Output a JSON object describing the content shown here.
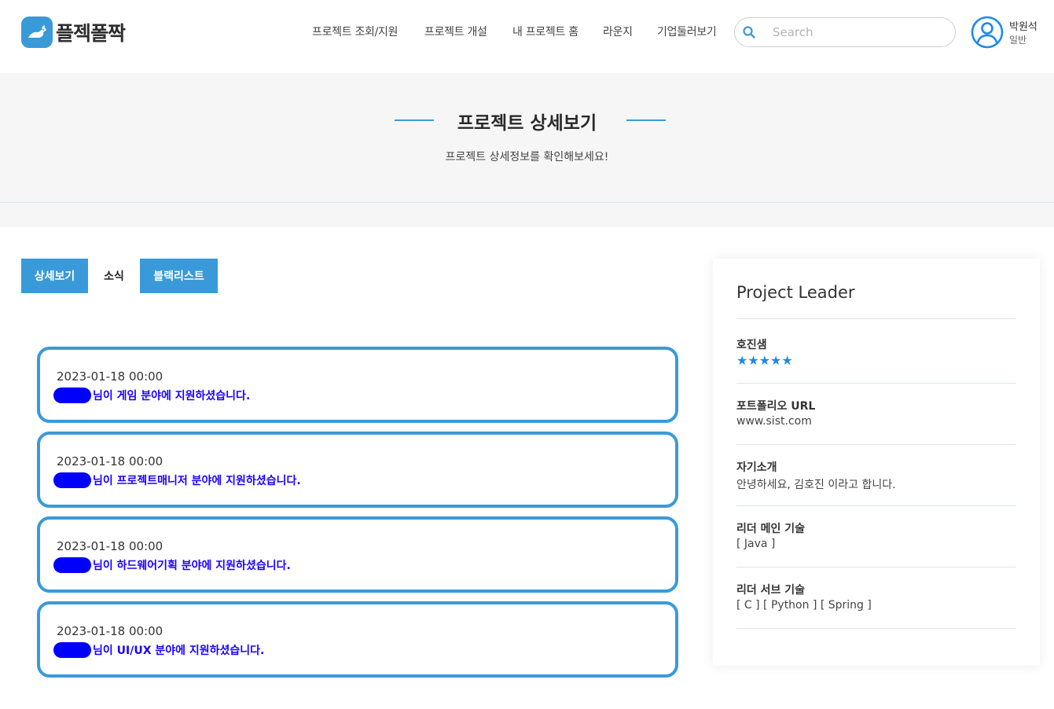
{
  "header": {
    "logo_text": "플젝폴짝",
    "nav": [
      {
        "label": "프로젝트 조회/지원"
      },
      {
        "label": "프로젝트 개설"
      },
      {
        "label": "내 프로젝트 홈"
      },
      {
        "label": "라운지"
      },
      {
        "label": "기업둘러보기"
      }
    ],
    "search_placeholder": "Search",
    "user": {
      "name": "박원석",
      "role": "일반"
    }
  },
  "banner": {
    "title": "프로젝트 상세보기",
    "subtitle": "프로젝트 상세정보를 확인해보세요!"
  },
  "tabs": [
    {
      "label": "상세보기"
    },
    {
      "label": "소식"
    },
    {
      "label": "블랙리스트"
    }
  ],
  "notifications": [
    {
      "date": "2023-01-18 00:00",
      "message": "님이 게임 분야에 지원하셨습니다."
    },
    {
      "date": "2023-01-18 00:00",
      "message": "님이 프로젝트매니저 분야에 지원하셨습니다."
    },
    {
      "date": "2023-01-18 00:00",
      "message": "님이 하드웨어기획 분야에 지원하셨습니다."
    },
    {
      "date": "2023-01-18 00:00",
      "message": "님이 UI/UX 분야에 지원하셨습니다."
    }
  ],
  "leader": {
    "title": "Project Leader",
    "name": "호진샘",
    "stars": "★★★★★",
    "portfolio_label": "포트폴리오 URL",
    "portfolio_value": "www.sist.com",
    "intro_label": "자기소개",
    "intro_value": "안녕하세요, 김호진 이라고 합니다.",
    "main_skill_label": "리더 메인 기술",
    "main_skill_value": "[ Java ]",
    "sub_skill_label": "리더 서브 기술",
    "sub_skill_value": "[ C ] [ Python ] [ Spring ]"
  },
  "colors": {
    "accent": "#3a9ad9",
    "redacted": "#0000ff",
    "message_text": "#1a00ff",
    "star": "#1d8ae8"
  }
}
